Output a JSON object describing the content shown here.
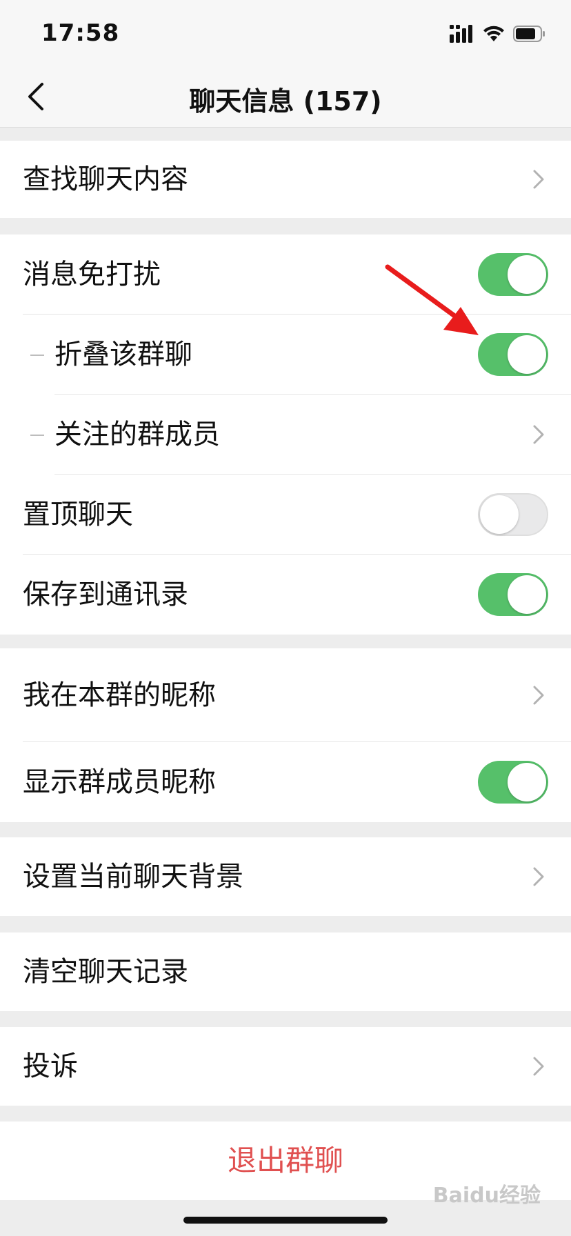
{
  "status_bar": {
    "time": "17:58"
  },
  "nav": {
    "title": "聊天信息 (157)"
  },
  "sections": {
    "search_history": "查找聊天内容",
    "mute": "消息免打扰",
    "fold_group": "折叠该群聊",
    "followed_members": "关注的群成员",
    "sticky_on_top": "置顶聊天",
    "save_to_contacts": "保存到通讯录",
    "my_alias": "我在本群的昵称",
    "show_member_alias": "显示群成员昵称",
    "chat_background": "设置当前聊天背景",
    "clear_history": "清空聊天记录",
    "report": "投诉",
    "exit_group": "退出群聊"
  },
  "toggles": {
    "mute": "on",
    "fold_group": "on",
    "sticky_on_top": "off",
    "save_to_contacts": "on",
    "show_member_alias": "on"
  },
  "watermark": "Baidu经验",
  "colors": {
    "toggle_on": "#56c06a",
    "destructive": "#e05050",
    "annotation": "#e81c1c"
  },
  "icons": {
    "back": "chevron-left-icon",
    "chevron": "chevron-right-icon",
    "signal": "signal-icon",
    "wifi": "wifi-icon",
    "battery": "battery-icon"
  }
}
